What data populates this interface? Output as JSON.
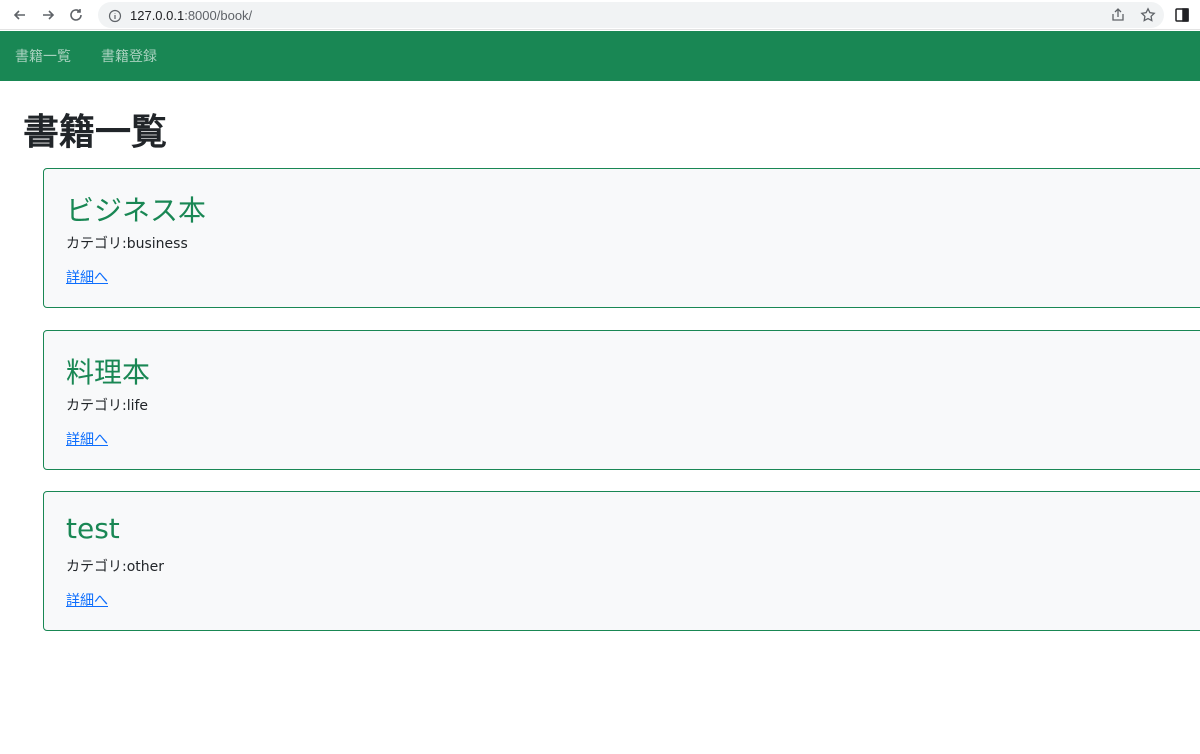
{
  "browser": {
    "url_host": "127.0.0.1",
    "url_rest": ":8000/book/"
  },
  "navbar": {
    "links": [
      "書籍一覧",
      "書籍登録"
    ]
  },
  "page": {
    "title": "書籍一覧"
  },
  "books": [
    {
      "title": "ビジネス本",
      "category": "カテゴリ:business",
      "link": "詳細へ"
    },
    {
      "title": "料理本",
      "category": "カテゴリ:life",
      "link": "詳細へ"
    },
    {
      "title": "test",
      "category": "カテゴリ:other",
      "link": "詳細へ"
    }
  ],
  "colors": {
    "brand": "#198754",
    "link": "#0d6efd",
    "card_bg": "#f8f9fa"
  }
}
